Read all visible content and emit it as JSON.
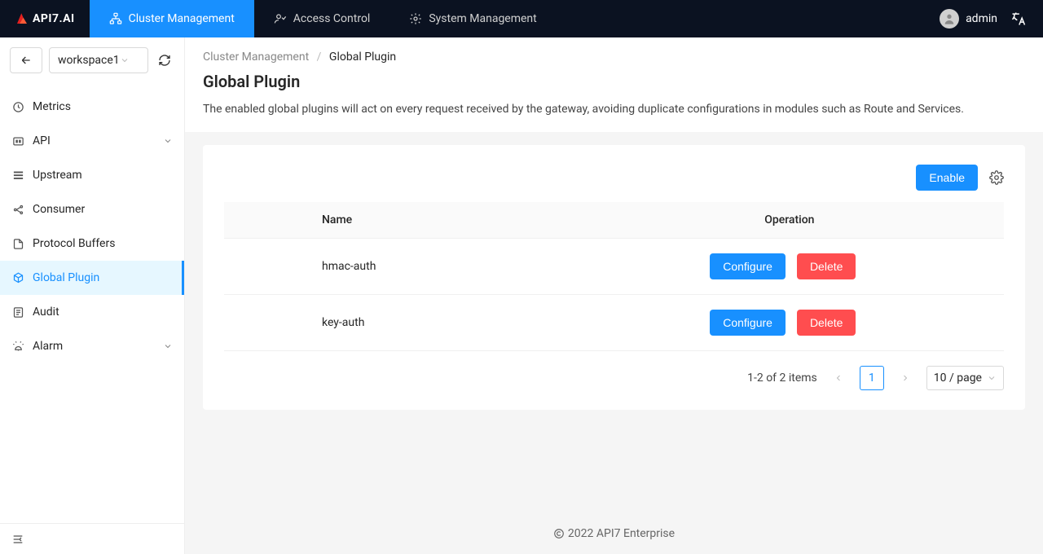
{
  "header": {
    "logo_text": "API7.AI",
    "nav": [
      {
        "label": "Cluster Management"
      },
      {
        "label": "Access Control"
      },
      {
        "label": "System Management"
      }
    ],
    "username": "admin"
  },
  "sidebar": {
    "workspace": "workspace1",
    "items": [
      {
        "label": "Metrics",
        "icon": "dashboard"
      },
      {
        "label": "API",
        "icon": "api",
        "expandable": true
      },
      {
        "label": "Upstream",
        "icon": "upstream"
      },
      {
        "label": "Consumer",
        "icon": "consumer"
      },
      {
        "label": "Protocol Buffers",
        "icon": "file"
      },
      {
        "label": "Global Plugin",
        "icon": "cube",
        "active": true
      },
      {
        "label": "Audit",
        "icon": "audit"
      },
      {
        "label": "Alarm",
        "icon": "alarm",
        "expandable": true
      }
    ]
  },
  "breadcrumb": {
    "parent": "Cluster Management",
    "current": "Global Plugin"
  },
  "page": {
    "title": "Global Plugin",
    "description": "The enabled global plugins will act on every request received by the gateway, avoiding duplicate configurations in modules such as Route and Services."
  },
  "toolbar": {
    "enable_label": "Enable"
  },
  "table": {
    "headers": {
      "name": "Name",
      "operation": "Operation"
    },
    "rows": [
      {
        "name": "hmac-auth"
      },
      {
        "name": "key-auth"
      }
    ],
    "configure_label": "Configure",
    "delete_label": "Delete"
  },
  "pagination": {
    "info": "1-2 of 2 items",
    "current_page": "1",
    "page_size": "10 / page"
  },
  "footer": {
    "text": "2022 API7 Enterprise"
  }
}
